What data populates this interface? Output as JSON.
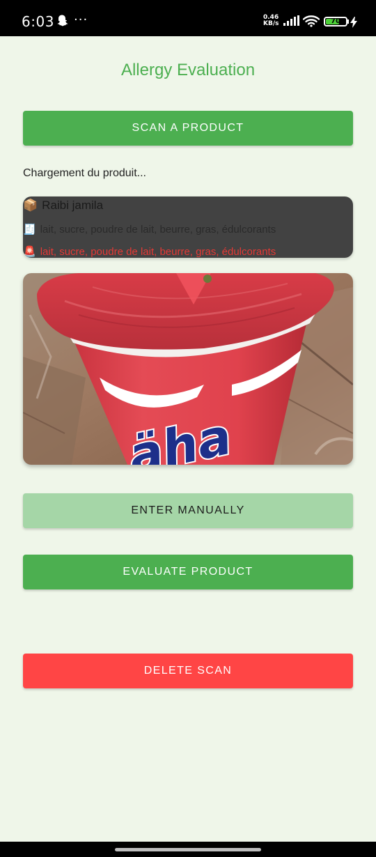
{
  "status_bar": {
    "time": "6:03",
    "more": "···",
    "net_speed_value": "0.46",
    "net_speed_unit": "KB/s",
    "battery_level": "70",
    "battery_fraction": 0.7,
    "icons": [
      "snapchat-ghost-icon",
      "signal-icon",
      "wifi-icon",
      "battery-icon",
      "charging-bolt-icon"
    ]
  },
  "page": {
    "title": "Allergy Evaluation",
    "scan_button": "SCAN A PRODUCT",
    "loading_text": "Chargement du produit...",
    "product": {
      "name_icon": "📦",
      "name": "Raibi jamila",
      "ingredients_icon": "🧾",
      "ingredients": "lait, sucre, poudre de lait, beurre, gras, édulcorants",
      "allergens_icon": "🚨",
      "allergens": "lait, sucre, poudre de lait, beurre, gras, édulcorants"
    },
    "manual_button": "ENTER MANUALLY",
    "evaluate_button": "EVALUATE PRODUCT",
    "delete_button": "DELETE SCAN"
  },
  "colors": {
    "background": "#eff6e9",
    "primary": "#4caf50",
    "primary_light": "#a5d6a7",
    "danger": "#ff4545",
    "card": "#424242",
    "allergen_text": "#e53935"
  }
}
